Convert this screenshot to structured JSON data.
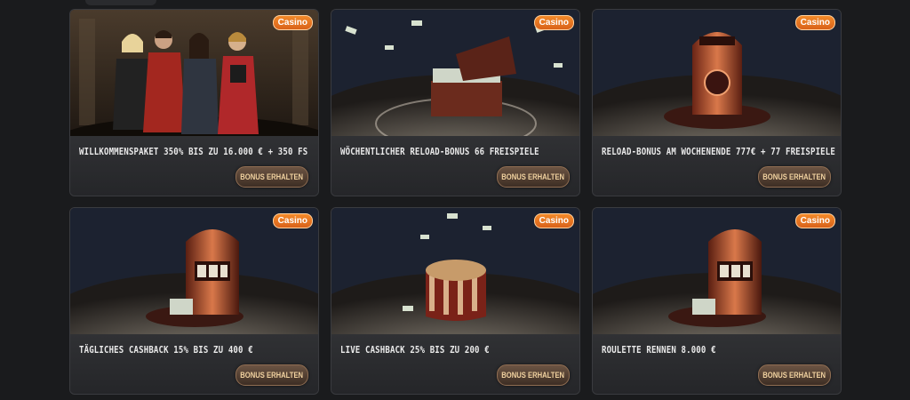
{
  "badge_label": "Casino",
  "button_label": "BONUS ERHALTEN",
  "colors": {
    "background": "#1a1b1d",
    "badge": "#e8741f",
    "button_text": "#f1d2a0"
  },
  "cards": [
    {
      "title": "WILLKOMMENSPAKET 350% BIS ZU 16.000 € + 350 FS",
      "image": "characters-group"
    },
    {
      "title": "WÖCHENTLICHER RELOAD-BONUS 66 FREISPIELE",
      "image": "money-chest"
    },
    {
      "title": "RELOAD-BONUS AM WOCHENENDE 777€ + 77 FREISPIELE",
      "image": "copper-safe"
    },
    {
      "title": "TÄGLICHES CASHBACK 15% BIS ZU 400 €",
      "image": "slot-machine"
    },
    {
      "title": "LIVE CASHBACK 25% BIS ZU 200 €",
      "image": "roulette-money"
    },
    {
      "title": "ROULETTE RENNEN 8.000 €",
      "image": "slot-machine"
    }
  ]
}
